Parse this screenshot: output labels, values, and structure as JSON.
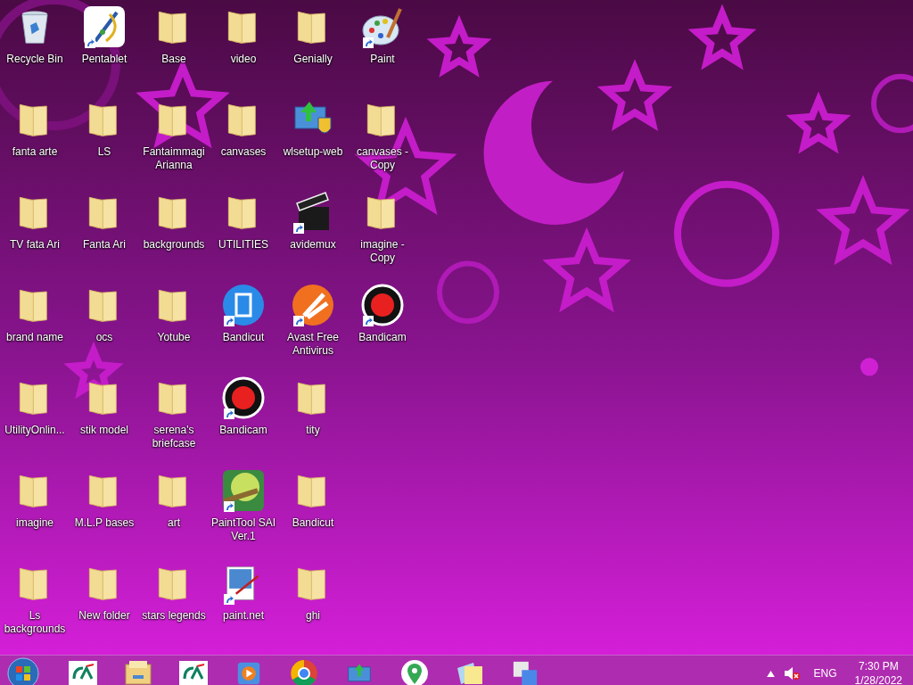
{
  "desktop": {
    "rows": [
      [
        {
          "label": "Recycle Bin",
          "kind": "recycle",
          "shortcut": false
        },
        {
          "label": "Pentablet",
          "kind": "pentablet",
          "shortcut": true
        },
        {
          "label": "Base",
          "kind": "folder",
          "shortcut": false
        },
        {
          "label": "video",
          "kind": "folder",
          "shortcut": false
        },
        {
          "label": "Genially",
          "kind": "folder",
          "shortcut": false
        },
        {
          "label": "Paint",
          "kind": "paint",
          "shortcut": true
        }
      ],
      [
        {
          "label": "fanta arte",
          "kind": "folder",
          "shortcut": false
        },
        {
          "label": "LS",
          "kind": "folder",
          "shortcut": false
        },
        {
          "label": "Fantaimmagi Arianna",
          "kind": "folder",
          "shortcut": false
        },
        {
          "label": "canvases",
          "kind": "folder",
          "shortcut": false
        },
        {
          "label": "wlsetup-web",
          "kind": "installer",
          "shortcut": false
        },
        {
          "label": "canvases - Copy",
          "kind": "folder",
          "shortcut": false
        }
      ],
      [
        {
          "label": "TV  fata Ari",
          "kind": "folder",
          "shortcut": false
        },
        {
          "label": "Fanta Ari",
          "kind": "folder",
          "shortcut": false
        },
        {
          "label": "backgrounds",
          "kind": "folder",
          "shortcut": false
        },
        {
          "label": "UTILITIES",
          "kind": "folder",
          "shortcut": false
        },
        {
          "label": "avidemux",
          "kind": "clapper",
          "shortcut": true
        },
        {
          "label": "imagine - Copy",
          "kind": "folder",
          "shortcut": false
        }
      ],
      [
        {
          "label": "brand name",
          "kind": "folder",
          "shortcut": false
        },
        {
          "label": "ocs",
          "kind": "folder",
          "shortcut": false
        },
        {
          "label": "Yotube",
          "kind": "folder",
          "shortcut": false
        },
        {
          "label": "Bandicut",
          "kind": "bandicut",
          "shortcut": true
        },
        {
          "label": "Avast Free Antivirus",
          "kind": "avast",
          "shortcut": true
        },
        {
          "label": "Bandicam",
          "kind": "bandicam",
          "shortcut": true
        }
      ],
      [
        {
          "label": "UtilityOnlin...",
          "kind": "folder",
          "shortcut": false
        },
        {
          "label": "stik  model",
          "kind": "folder",
          "shortcut": false
        },
        {
          "label": "serena's briefcase",
          "kind": "folder",
          "shortcut": false
        },
        {
          "label": "Bandicam",
          "kind": "bandicam",
          "shortcut": true
        },
        {
          "label": "tity",
          "kind": "folder",
          "shortcut": false
        }
      ],
      [
        {
          "label": "imagine",
          "kind": "folder",
          "shortcut": false
        },
        {
          "label": "M.L.P bases",
          "kind": "folder",
          "shortcut": false
        },
        {
          "label": "art",
          "kind": "folder",
          "shortcut": false
        },
        {
          "label": "PaintTool SAI Ver.1",
          "kind": "sai",
          "shortcut": true
        },
        {
          "label": "Bandicut",
          "kind": "folder",
          "shortcut": false
        }
      ],
      [
        {
          "label": "Ls backgrounds",
          "kind": "folder",
          "shortcut": false
        },
        {
          "label": "New folder",
          "kind": "folder",
          "shortcut": false
        },
        {
          "label": "stars legends",
          "kind": "folder",
          "shortcut": false
        },
        {
          "label": "paint.net",
          "kind": "paintnet",
          "shortcut": true
        },
        {
          "label": "ghi",
          "kind": "folder",
          "shortcut": false
        }
      ]
    ]
  },
  "taskbar": {
    "pinned": [
      {
        "kind": "bank"
      },
      {
        "kind": "explorer"
      },
      {
        "kind": "bank"
      },
      {
        "kind": "player"
      },
      {
        "kind": "chrome"
      },
      {
        "kind": "monitor"
      },
      {
        "kind": "maps"
      },
      {
        "kind": "notes"
      },
      {
        "kind": "translate"
      }
    ],
    "tray": {
      "language": "ENG",
      "muted": true,
      "time": "7:30 PM",
      "date": "1/28/2022"
    }
  }
}
